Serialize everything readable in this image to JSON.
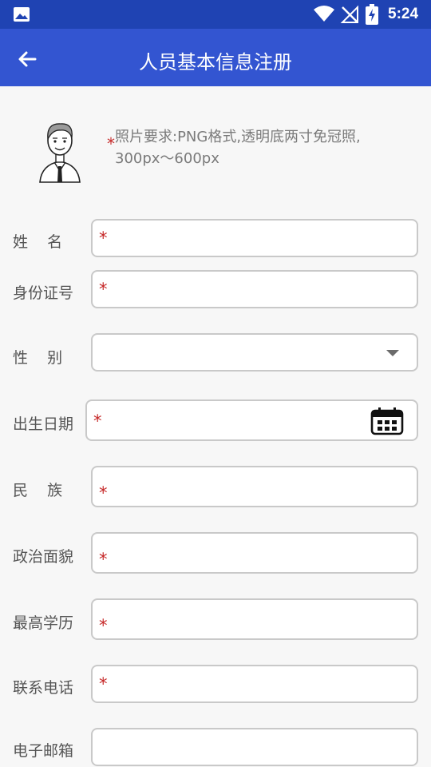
{
  "status_bar": {
    "time": "5:24",
    "icons": [
      "gallery-icon",
      "wifi-icon",
      "no-signal-icon",
      "battery-charging-icon"
    ]
  },
  "app_bar": {
    "title": "人员基本信息注册",
    "back_icon": "arrow-left-icon"
  },
  "photo": {
    "required_mark": "*",
    "requirement_line1": "照片要求:PNG格式,透明底两寸免冠照,",
    "requirement_line2": "300px～600px",
    "avatar_icon": "person-avatar-icon"
  },
  "form": {
    "name": {
      "label": "姓    名",
      "required_mark": "*",
      "value": ""
    },
    "id_number": {
      "label": "身份证号",
      "required_mark": "*",
      "value": ""
    },
    "gender": {
      "label": "性    别",
      "value": ""
    },
    "birth_date": {
      "label": "出生日期",
      "required_mark": "*",
      "value": ""
    },
    "ethnicity": {
      "label": "民    族",
      "required_mark": "*",
      "value": ""
    },
    "political_status": {
      "label": "政治面貌",
      "required_mark": "*",
      "value": ""
    },
    "education": {
      "label": "最高学历",
      "required_mark": "*",
      "value": ""
    },
    "phone": {
      "label": "联系电话",
      "required_mark": "*",
      "value": ""
    },
    "email": {
      "label": "电子邮箱",
      "value": ""
    }
  },
  "colors": {
    "status_bar": "#1f43b3",
    "app_bar": "#3355d1",
    "required": "#c62828",
    "field_border": "#c9c9c9"
  }
}
